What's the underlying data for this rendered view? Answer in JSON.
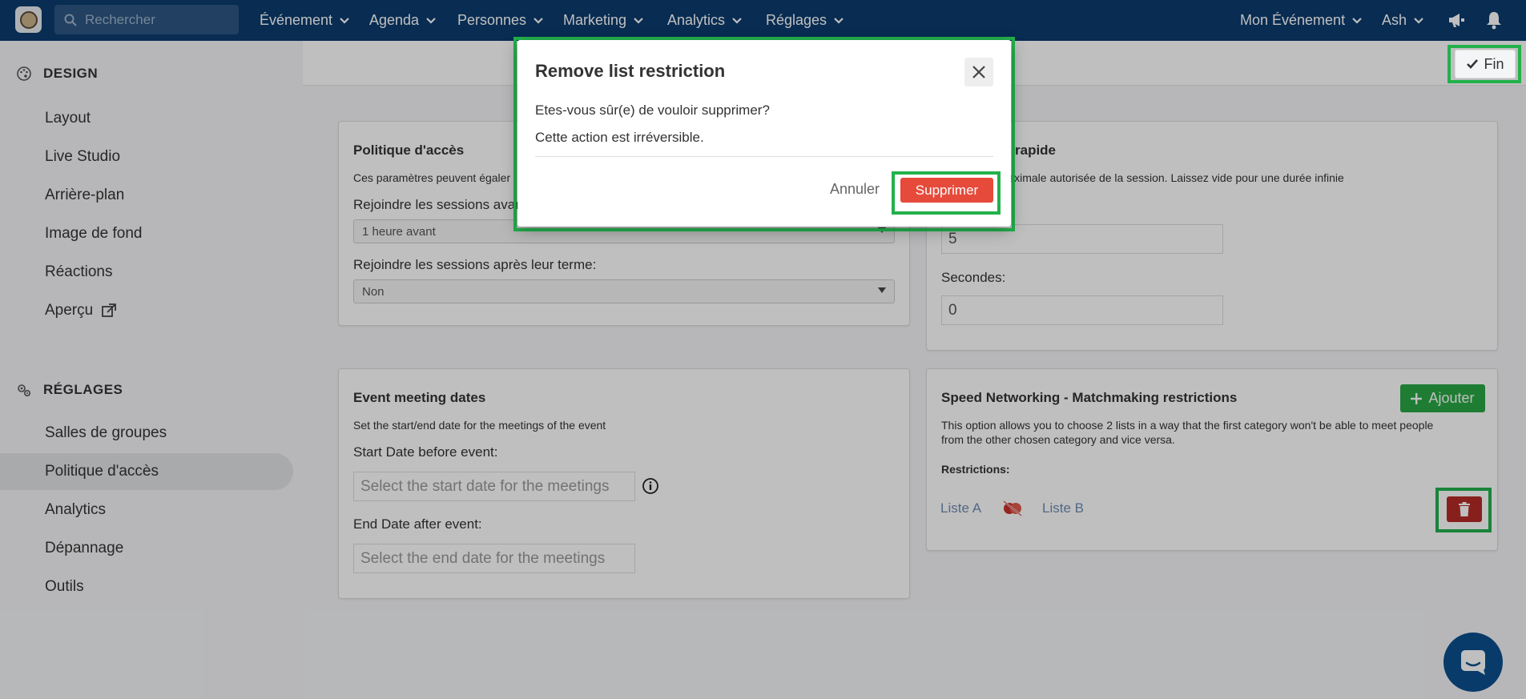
{
  "nav": {
    "search_placeholder": "Rechercher",
    "items": [
      {
        "label": "Événement"
      },
      {
        "label": "Agenda"
      },
      {
        "label": "Personnes"
      },
      {
        "label": "Marketing"
      },
      {
        "label": "Analytics"
      },
      {
        "label": "Réglages"
      }
    ],
    "event_selector": "Mon Événement",
    "user": "Ash",
    "icons": [
      "megaphone-icon",
      "bell-icon"
    ]
  },
  "sidebar": {
    "design_title": "DESIGN",
    "design_items": [
      "Layout",
      "Live Studio",
      "Arrière-plan",
      "Image de fond",
      "Réactions",
      "Aperçu"
    ],
    "settings_title": "RÉGLAGES",
    "settings_items": [
      "Salles de groupes",
      "Politique d'accès",
      "Analytics",
      "Dépannage",
      "Outils"
    ],
    "active_item": "Politique d'accès"
  },
  "toolbar": {
    "fin_label": "Fin"
  },
  "access_card": {
    "title": "Politique d'accès",
    "desc": "Ces paramètres peuvent égaler",
    "join_before_label": "Rejoindre les sessions avan",
    "join_before_value": "1 heure avant",
    "join_after_label": "Rejoindre les sessions après leur terme:",
    "join_after_value": "Non"
  },
  "speed_card": {
    "title_partial": "rapide",
    "desc": "e maximale autorisée de la session. Laissez vide pour une durée infinie",
    "minutes_value": "5",
    "seconds_label": "Secondes:",
    "seconds_value": "0"
  },
  "meeting_card": {
    "title": "Event meeting dates",
    "desc": "Set the start/end date for the meetings of the event",
    "start_label": "Start Date before event:",
    "start_placeholder": "Select the start date for the meetings",
    "end_label": "End Date after event:",
    "end_placeholder": "Select the end date for the meetings"
  },
  "match_card": {
    "title": "Speed Networking - Matchmaking restrictions",
    "add_label": "Ajouter",
    "desc1": "This option allows you to choose 2 lists in a way that the first category won't be able to meet people",
    "desc2": "from the other chosen category and vice versa.",
    "restrictions_label": "Restrictions:",
    "list_a": "Liste A",
    "list_b": "Liste B"
  },
  "modal": {
    "title": "Remove list restriction",
    "line1": "Etes-vous sûr(e) de vouloir supprimer?",
    "line2": "Cette action est irréversible.",
    "cancel_label": "Annuler",
    "confirm_label": "Supprimer"
  },
  "colors": {
    "nav_bg": "#0b3b6e",
    "danger": "#e64a3b",
    "success": "#28a745",
    "highlight": "#22b14c"
  }
}
